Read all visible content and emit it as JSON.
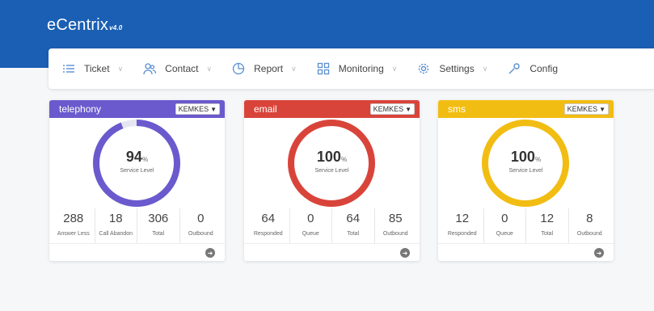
{
  "app": {
    "logo": "eCentrix",
    "logo_sup": "v4.0"
  },
  "nav": [
    {
      "label": "Ticket",
      "icon": "list-icon"
    },
    {
      "label": "Contact",
      "icon": "contacts-icon"
    },
    {
      "label": "Report",
      "icon": "report-icon"
    },
    {
      "label": "Monitoring",
      "icon": "grid-icon"
    },
    {
      "label": "Settings",
      "icon": "gear-icon"
    },
    {
      "label": "Config",
      "icon": "wrench-icon"
    }
  ],
  "cards": [
    {
      "title": "telephony",
      "color": "#6a5acd",
      "select": "KEMKES",
      "service_level": 94,
      "percent_sign": "%",
      "service_label": "Service Level",
      "stats": [
        {
          "value": "288",
          "label": "Answer Less"
        },
        {
          "value": "18",
          "label": "Call Abandon"
        },
        {
          "value": "306",
          "label": "Total"
        },
        {
          "value": "0",
          "label": "Outbound"
        }
      ]
    },
    {
      "title": "email",
      "color": "#d9443a",
      "select": "KEMKES",
      "service_level": 100,
      "percent_sign": "%",
      "service_label": "Service Level",
      "stats": [
        {
          "value": "64",
          "label": "Responded"
        },
        {
          "value": "0",
          "label": "Queue"
        },
        {
          "value": "64",
          "label": "Total"
        },
        {
          "value": "85",
          "label": "Outbound"
        }
      ]
    },
    {
      "title": "sms",
      "color": "#f2bd12",
      "select": "KEMKES",
      "service_level": 100,
      "percent_sign": "%",
      "service_label": "Service Level",
      "stats": [
        {
          "value": "12",
          "label": "Responded"
        },
        {
          "value": "0",
          "label": "Queue"
        },
        {
          "value": "12",
          "label": "Total"
        },
        {
          "value": "8",
          "label": "Outbound"
        }
      ]
    }
  ]
}
